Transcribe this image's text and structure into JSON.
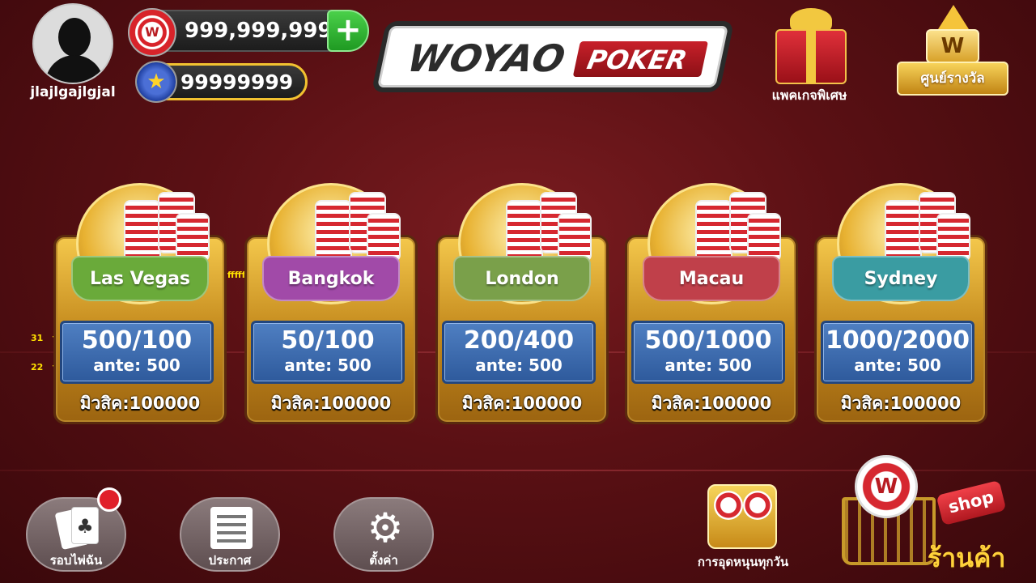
{
  "player": {
    "name": "jlajlgajlgjal",
    "chips": "999,999,999",
    "chip_icon_letter": "W",
    "plus_label": "+",
    "stars": "99999999",
    "star_icon": "★"
  },
  "logo": {
    "woyao": "WOYAO",
    "poker": "POKER"
  },
  "header": {
    "special_package_label": "แพคเกจพิเศษ",
    "rewards_center_label": "ศูนย์รางวัล",
    "rewards_badge_letter": "W"
  },
  "debug_labels": {
    "title_size": "39",
    "title_color": "ffffff",
    "blinds_size": "31",
    "blinds_color": "ffffff",
    "ante_size": "22",
    "ante_color": "ffffff"
  },
  "rooms": [
    {
      "city": "Las Vegas",
      "blinds": "500/100",
      "ante": "ante: 500",
      "min_buyin": "มิวสิค:100000",
      "banner_color": "#6aaa3a"
    },
    {
      "city": "Bangkok",
      "blinds": "50/100",
      "ante": "ante: 500",
      "min_buyin": "มิวสิค:100000",
      "banner_color": "#a14aa8"
    },
    {
      "city": "London",
      "blinds": "200/400",
      "ante": "ante: 500",
      "min_buyin": "มิวสิค:100000",
      "banner_color": "#7aa04a"
    },
    {
      "city": "Macau",
      "blinds": "500/1000",
      "ante": "ante: 500",
      "min_buyin": "มิวสิค:100000",
      "banner_color": "#c0404a"
    },
    {
      "city": "Sydney",
      "blinds": "1000/2000",
      "ante": "ante: 500",
      "min_buyin": "มิวสิค:100000",
      "banner_color": "#3a9ca2"
    }
  ],
  "bottom": {
    "hand_history_label": "รอบไพ่ฉัน",
    "hand_history_icon": "♣",
    "announcement_label": "ประกาศ",
    "settings_label": "ตั้งค่า",
    "settings_icon": "⚙",
    "daily_support_label": "การอุดหนุนทุกวัน",
    "shop_tag": "shop",
    "shop_label": "ร้านค้า",
    "shop_chip_letter": "W"
  }
}
